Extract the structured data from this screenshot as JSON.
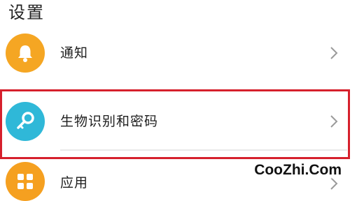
{
  "header": {
    "title": "设置"
  },
  "items": [
    {
      "label": "通知",
      "icon": "bell-icon",
      "icon_color": "#f5a623"
    },
    {
      "label": "生物识别和密码",
      "icon": "key-icon",
      "icon_color": "#2fb8d8"
    },
    {
      "label": "应用",
      "icon": "grid-apps-icon",
      "icon_color": "#f5a020"
    }
  ],
  "highlight": {
    "color": "#d6202c"
  },
  "watermark": {
    "text": "CooZhi.Com"
  }
}
